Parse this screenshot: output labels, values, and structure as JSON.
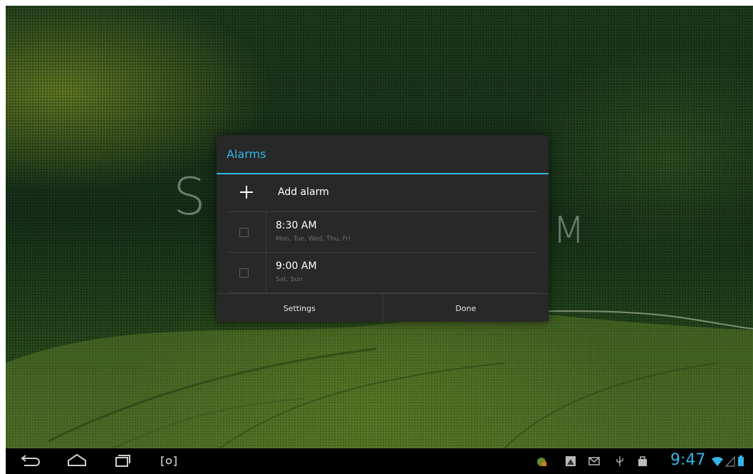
{
  "background": {
    "ghost_letters": [
      "S",
      "M"
    ]
  },
  "dialog": {
    "title": "Alarms",
    "add_alarm_label": "Add alarm",
    "alarms": [
      {
        "time": "8:30 AM",
        "days": "Mon, Tue, Wed, Thu, Fri",
        "enabled": false
      },
      {
        "time": "9:00 AM",
        "days": "Sat, Sun",
        "enabled": false
      }
    ],
    "settings_label": "Settings",
    "done_label": "Done"
  },
  "system_bar": {
    "clock": "9:47",
    "nav_icons": [
      "back-icon",
      "home-icon",
      "recent-apps-icon",
      "screenshot-icon"
    ],
    "status_icons": [
      "app-notification-icon",
      "image-notification-icon",
      "gmail-icon",
      "usb-icon",
      "shopping-bag-icon",
      "wifi-icon",
      "signal-icon",
      "battery-icon"
    ]
  },
  "colors": {
    "accent": "#33b5e5",
    "dialog_bg": "#282828",
    "nav_bg": "#000000"
  }
}
